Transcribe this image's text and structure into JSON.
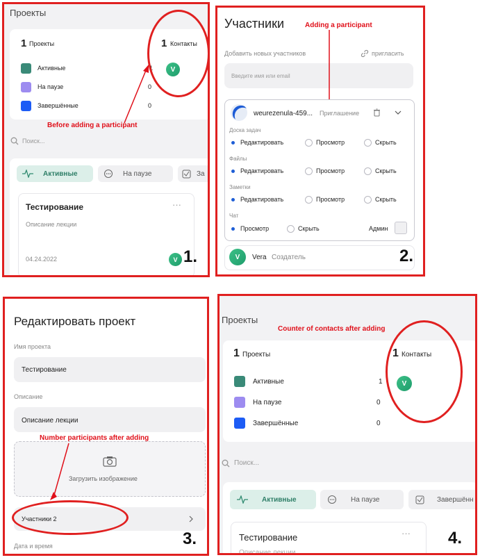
{
  "panel1": {
    "header": "Проекты",
    "stats": {
      "projects_count": "1",
      "projects_label": "Проекты",
      "contacts_count": "1",
      "contacts_label": "Контакты",
      "rows": [
        {
          "label": "Активные",
          "count": "1",
          "color": "#3a8a78"
        },
        {
          "label": "На паузе",
          "count": "0",
          "color": "#9d8cf0"
        },
        {
          "label": "Завершённые",
          "count": "0",
          "color": "#1d5cf5"
        }
      ],
      "avatar_letter": "V"
    },
    "annotation": "Before adding a participant",
    "search_placeholder": "Поиск...",
    "tabs": [
      {
        "label": "Активные"
      },
      {
        "label": "На паузе"
      },
      {
        "label": "За"
      }
    ],
    "project_card": {
      "title": "Тестирование",
      "description": "Описание лекции",
      "date": "04.24.2022",
      "more": "···",
      "avatar_letter": "V"
    },
    "step_number": "1."
  },
  "panel2": {
    "title": "Участники",
    "annotation": "Adding a participant",
    "add_label": "Добавить новых участников",
    "invite_label": "пригласить",
    "input_placeholder": "Введите имя или email",
    "participant": {
      "name": "weurezenula-459...",
      "status": "Приглашение"
    },
    "sections": [
      {
        "title": "Доска задач",
        "options": [
          "Редактировать",
          "Просмотр",
          "Скрыть"
        ],
        "selected": 0
      },
      {
        "title": "Файлы",
        "options": [
          "Редактировать",
          "Просмотр",
          "Скрыть"
        ],
        "selected": 0
      },
      {
        "title": "Заметки",
        "options": [
          "Редактировать",
          "Просмотр",
          "Скрыть"
        ],
        "selected": 0
      },
      {
        "title": "Чат",
        "options": [
          "Просмотр",
          "Скрыть"
        ],
        "selected": 0
      }
    ],
    "admin_label": "Админ",
    "creator": {
      "letter": "V",
      "name": "Vera",
      "role": "Создатель"
    },
    "step_number": "2."
  },
  "panel3": {
    "title": "Редактировать проект",
    "name_label": "Имя проекта",
    "name_value": "Тестирование",
    "desc_label": "Описание",
    "desc_value": "Описание лекции",
    "annotation": "Number participants after adding",
    "upload_label": "Загрузить изображение",
    "participants_label": "Участники 2",
    "date_label": "Дата и время",
    "step_number": "3."
  },
  "panel4": {
    "header": "Проекты",
    "annotation": "Counter of contacts after adding",
    "stats": {
      "projects_count": "1",
      "projects_label": "Проекты",
      "contacts_count": "1",
      "contacts_label": "Контакты",
      "rows": [
        {
          "label": "Активные",
          "count": "1",
          "color": "#3a8a78"
        },
        {
          "label": "На паузе",
          "count": "0",
          "color": "#9d8cf0"
        },
        {
          "label": "Завершённые",
          "count": "0",
          "color": "#1d5cf5"
        }
      ],
      "avatar_letter": "V"
    },
    "search_placeholder": "Поиск...",
    "tabs": [
      {
        "label": "Активные"
      },
      {
        "label": "На паузе"
      },
      {
        "label": "Завершённ"
      }
    ],
    "project_card": {
      "title": "Тестирование",
      "description": "Описание лекции",
      "more": "···"
    },
    "step_number": "4."
  }
}
